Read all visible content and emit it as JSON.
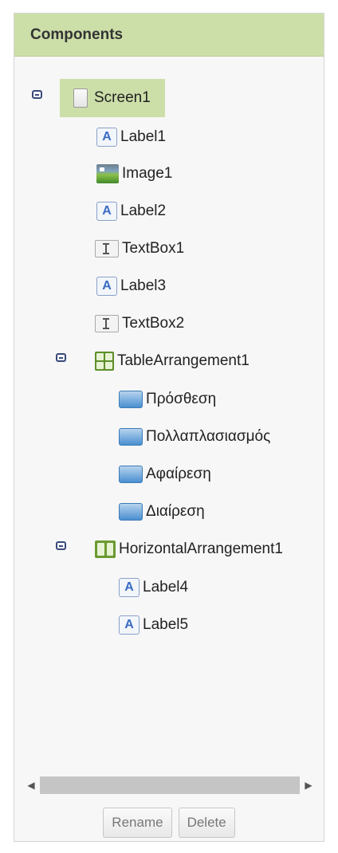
{
  "panel": {
    "title": "Components"
  },
  "tree": {
    "screen": "Screen1",
    "label1": "Label1",
    "image1": "Image1",
    "label2": "Label2",
    "textbox1": "TextBox1",
    "label3": "Label3",
    "textbox2": "TextBox2",
    "table_arrangement": "TableArrangement1",
    "btn_add": "Πρόσθεση",
    "btn_mul": "Πολλαπλασιασμός",
    "btn_sub": "Αφαίρεση",
    "btn_div": "Διαίρεση",
    "horizontal_arrangement": "HorizontalArrangement1",
    "label4": "Label4",
    "label5": "Label5"
  },
  "scrollbar": {
    "left_arrow": "◀",
    "right_arrow": "▶"
  },
  "actions": {
    "rename": "Rename",
    "delete": "Delete"
  },
  "colors": {
    "header_bg": "#cddfa9",
    "selection_bg": "#cddfa9",
    "panel_bg": "#f7f7f7"
  },
  "icons": {
    "screen": "screen-icon",
    "label": "label-icon",
    "image": "image-icon",
    "textbox": "textbox-icon",
    "table": "table-arrangement-icon",
    "button": "button-icon",
    "horizontal": "horizontal-arrangement-icon",
    "collapse": "collapse-toggle-icon"
  }
}
